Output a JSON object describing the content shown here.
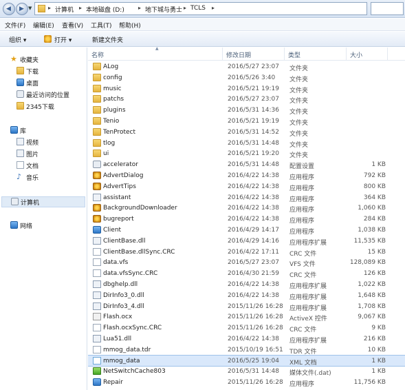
{
  "address": {
    "segments": [
      "计算机",
      "本地磁盘 (D:)",
      "地下城与勇士",
      "TCLS"
    ]
  },
  "menu": [
    "文件(F)",
    "编辑(E)",
    "查看(V)",
    "工具(T)",
    "帮助(H)"
  ],
  "toolbar": {
    "organize": "组织 ▾",
    "open": "打开 ▾",
    "new_folder": "新建文件夹"
  },
  "sidebar": {
    "favorites": "收藏夹",
    "downloads": "下载",
    "desktop": "桌面",
    "recent": "最近访问的位置",
    "dl2345": "2345下载",
    "library": "库",
    "videos": "视频",
    "pictures": "图片",
    "documents": "文档",
    "music": "音乐",
    "computer": "计算机",
    "network": "网络"
  },
  "columns": {
    "name": "名称",
    "date": "修改日期",
    "type": "类型",
    "size": "大小"
  },
  "files": [
    {
      "name": "ALog",
      "date": "2016/5/27 23:07",
      "type": "文件夹",
      "size": "",
      "icon": "folder"
    },
    {
      "name": "config",
      "date": "2016/5/26 3:40",
      "type": "文件夹",
      "size": "",
      "icon": "folder"
    },
    {
      "name": "music",
      "date": "2016/5/21 19:19",
      "type": "文件夹",
      "size": "",
      "icon": "folder"
    },
    {
      "name": "patchs",
      "date": "2016/5/27 23:07",
      "type": "文件夹",
      "size": "",
      "icon": "folder"
    },
    {
      "name": "plugins",
      "date": "2016/5/31 14:36",
      "type": "文件夹",
      "size": "",
      "icon": "folder"
    },
    {
      "name": "Tenio",
      "date": "2016/5/21 19:19",
      "type": "文件夹",
      "size": "",
      "icon": "folder"
    },
    {
      "name": "TenProtect",
      "date": "2016/5/31 14:52",
      "type": "文件夹",
      "size": "",
      "icon": "folder"
    },
    {
      "name": "tlog",
      "date": "2016/5/31 14:48",
      "type": "文件夹",
      "size": "",
      "icon": "folder"
    },
    {
      "name": "ui",
      "date": "2016/5/21 19:20",
      "type": "文件夹",
      "size": "",
      "icon": "folder"
    },
    {
      "name": "accelerator",
      "date": "2016/5/31 14:48",
      "type": "配置设置",
      "size": "1 KB",
      "icon": "cfg"
    },
    {
      "name": "AdvertDialog",
      "date": "2016/4/22 14:38",
      "type": "应用程序",
      "size": "792 KB",
      "icon": "exe"
    },
    {
      "name": "AdvertTips",
      "date": "2016/4/22 14:38",
      "type": "应用程序",
      "size": "800 KB",
      "icon": "exe"
    },
    {
      "name": "assistant",
      "date": "2016/4/22 14:38",
      "type": "应用程序",
      "size": "364 KB",
      "icon": "dll"
    },
    {
      "name": "BackgroundDownloader",
      "date": "2016/4/22 14:38",
      "type": "应用程序",
      "size": "1,060 KB",
      "icon": "exe"
    },
    {
      "name": "bugreport",
      "date": "2016/4/22 14:38",
      "type": "应用程序",
      "size": "284 KB",
      "icon": "exe"
    },
    {
      "name": "Client",
      "date": "2016/4/29 14:17",
      "type": "应用程序",
      "size": "1,038 KB",
      "icon": "blue"
    },
    {
      "name": "ClientBase.dll",
      "date": "2016/4/29 14:16",
      "type": "应用程序扩展",
      "size": "11,535 KB",
      "icon": "dll"
    },
    {
      "name": "ClientBase.dllSync.CRC",
      "date": "2016/4/22 17:11",
      "type": "CRC 文件",
      "size": "15 KB",
      "icon": "doc"
    },
    {
      "name": "data.vfs",
      "date": "2016/5/27 23:07",
      "type": "VFS 文件",
      "size": "128,089 KB",
      "icon": "doc"
    },
    {
      "name": "data.vfsSync.CRC",
      "date": "2016/4/30 21:59",
      "type": "CRC 文件",
      "size": "126 KB",
      "icon": "doc"
    },
    {
      "name": "dbghelp.dll",
      "date": "2016/4/22 14:38",
      "type": "应用程序扩展",
      "size": "1,022 KB",
      "icon": "dll"
    },
    {
      "name": "DirInfo3_0.dll",
      "date": "2016/4/22 14:38",
      "type": "应用程序扩展",
      "size": "1,648 KB",
      "icon": "dll"
    },
    {
      "name": "DirInfo3_4.dll",
      "date": "2015/11/26 16:28",
      "type": "应用程序扩展",
      "size": "1,708 KB",
      "icon": "dll"
    },
    {
      "name": "Flash.ocx",
      "date": "2015/11/26 16:28",
      "type": "ActiveX 控件",
      "size": "9,067 KB",
      "icon": "ax"
    },
    {
      "name": "Flash.ocxSync.CRC",
      "date": "2015/11/26 16:28",
      "type": "CRC 文件",
      "size": "9 KB",
      "icon": "doc"
    },
    {
      "name": "Lua51.dll",
      "date": "2016/4/22 14:38",
      "type": "应用程序扩展",
      "size": "216 KB",
      "icon": "dll"
    },
    {
      "name": "mmog_data.tdr",
      "date": "2015/10/19 16:51",
      "type": "TDR 文件",
      "size": "10 KB",
      "icon": "doc"
    },
    {
      "name": "mmog_data",
      "date": "2016/5/25 19:04",
      "type": "XML 文档",
      "size": "1 KB",
      "icon": "xml"
    },
    {
      "name": "NetSwitchCache803",
      "date": "2016/5/31 14:48",
      "type": "媒体文件(.dat)",
      "size": "1 KB",
      "icon": "net"
    },
    {
      "name": "Repair",
      "date": "2015/11/26 16:28",
      "type": "应用程序",
      "size": "11,756 KB",
      "icon": "blue"
    }
  ],
  "selected_file": "mmog_data"
}
